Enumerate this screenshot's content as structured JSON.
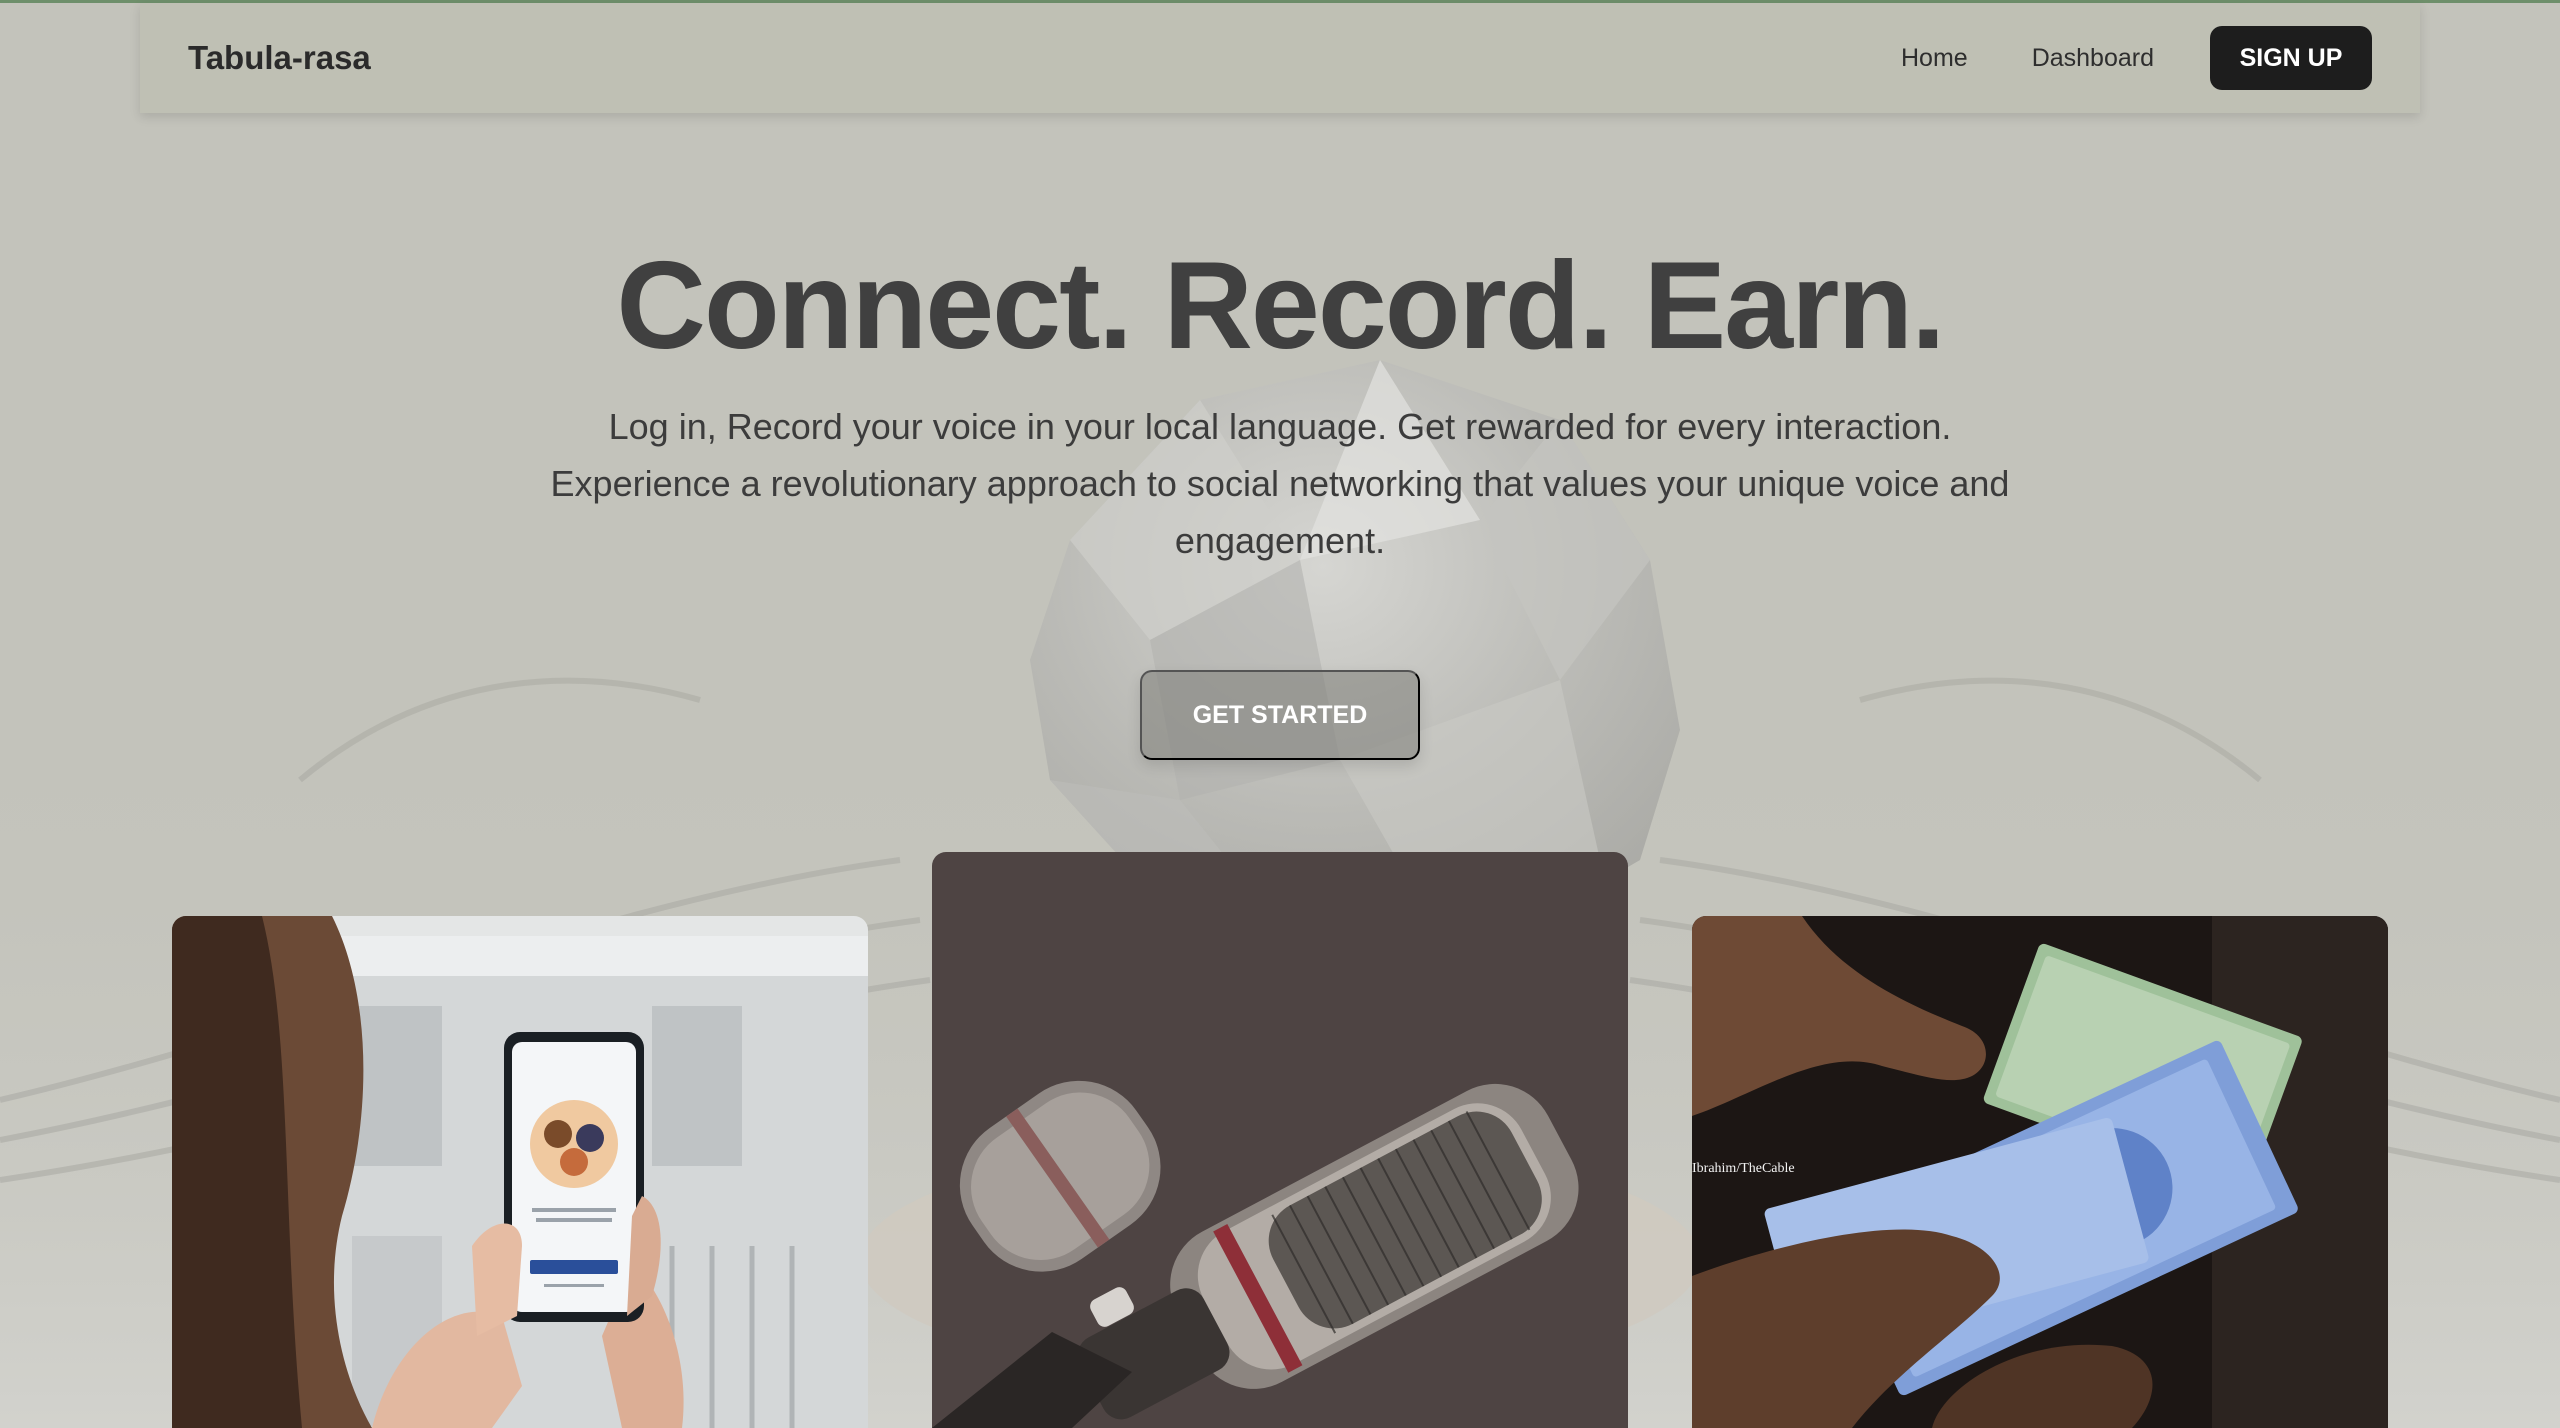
{
  "header": {
    "brand": "Tabula-rasa",
    "nav": [
      "Home",
      "Dashboard"
    ],
    "signup_label": "SIGN UP"
  },
  "hero": {
    "title": "Connect. Record. Earn.",
    "subtitle": "Log in, Record your voice in your local language. Get rewarded for every interaction. Experience a revolutionary approach to social networking that values your unique voice and engagement.",
    "cta_label": "GET STARTED"
  },
  "cards": [
    {
      "image": "person-holding-phone-app-photo"
    },
    {
      "image": "studio-microphone-photo"
    },
    {
      "image": "hands-counting-banknotes-photo",
      "credit": "Ibrahim/TheCable"
    }
  ],
  "colors": {
    "background": "#c3c3bb",
    "navbar": "#bfc0b4",
    "signup_button": "#1d1d1d",
    "accent_line": "#6e8f6b"
  }
}
